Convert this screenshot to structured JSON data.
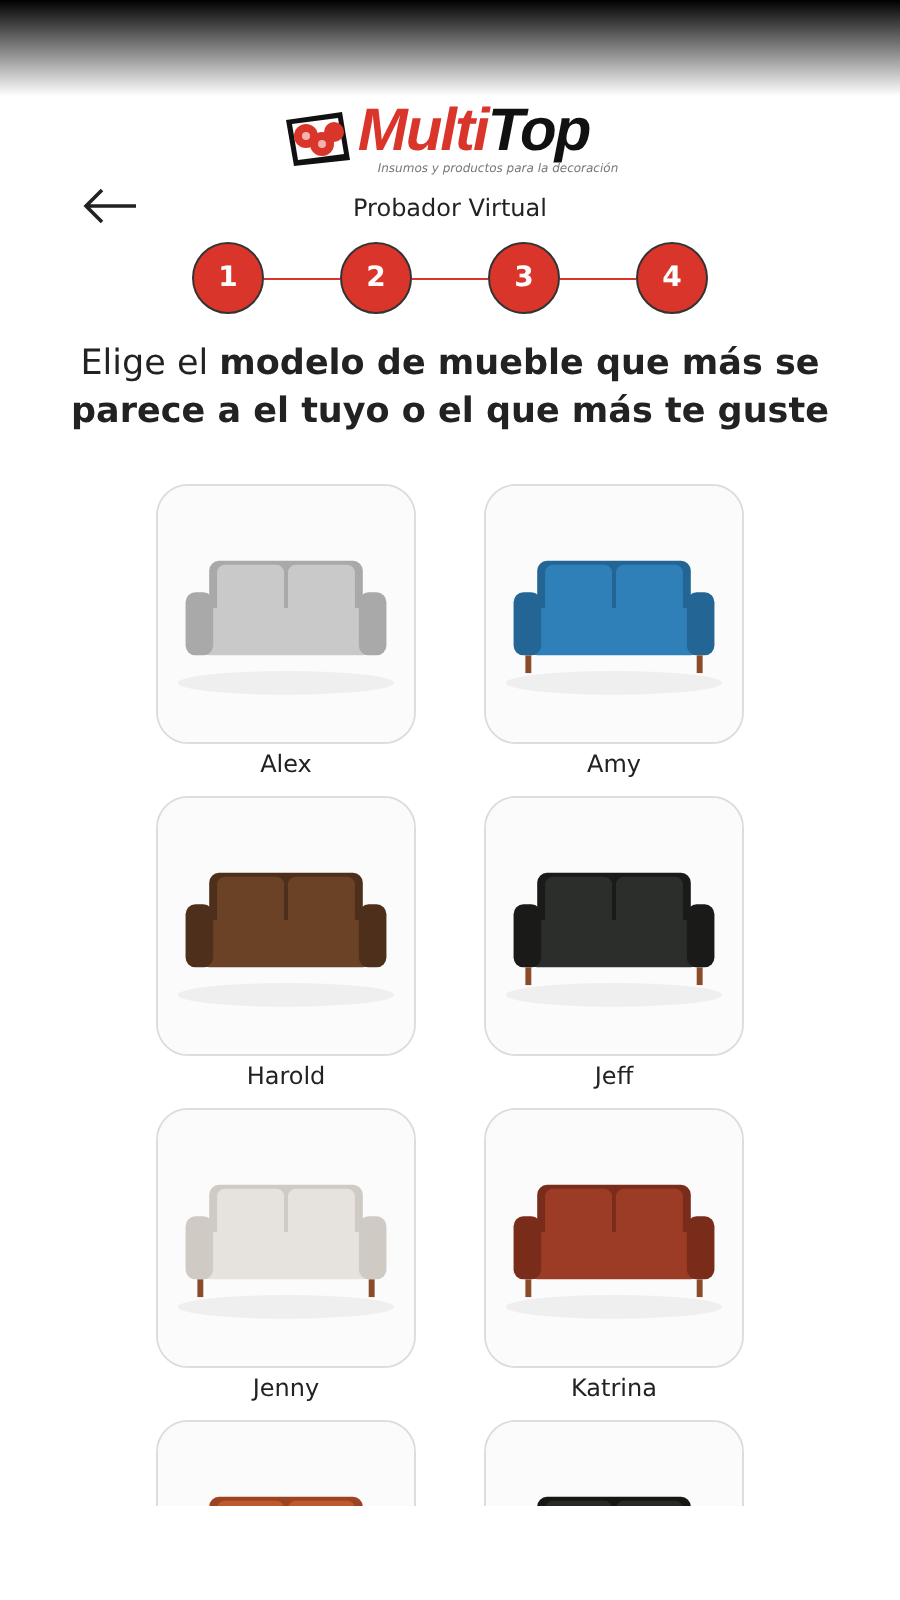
{
  "logo": {
    "brand_first": "Multi",
    "brand_second": "Top",
    "tagline": "Insumos y productos para la decoración"
  },
  "subtitle": "Probador Virtual",
  "steps": [
    "1",
    "2",
    "3",
    "4"
  ],
  "heading": "Elige el **modelo de mueble que más se parece a el tuyo o el que más te guste**",
  "models": [
    {
      "name": "Alex",
      "kind": "picture"
    },
    {
      "name": "Amy",
      "kind": "picture"
    },
    {
      "name": "Harold",
      "kind": "picture"
    },
    {
      "name": "Jeff",
      "kind": "picture"
    },
    {
      "name": "Jenny",
      "kind": "picture"
    },
    {
      "name": "Katrina",
      "kind": "picture"
    },
    {
      "kind": "picture"
    },
    {
      "kind": "picture"
    }
  ]
}
